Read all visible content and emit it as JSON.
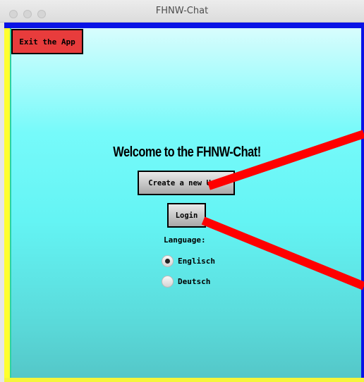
{
  "window": {
    "title": "FHNW-Chat"
  },
  "toolbar": {
    "exit_label": "Exit the App"
  },
  "main": {
    "welcome": "Welcome to the FHNW-Chat!",
    "create_user_label": "Create a new User",
    "login_label": "Login"
  },
  "language": {
    "label": "Language:",
    "options": [
      {
        "label": "Englisch",
        "selected": true
      },
      {
        "label": "Deutsch",
        "selected": false
      }
    ]
  },
  "colors": {
    "frame_yellow": "#ffff2e",
    "frame_blue": "#0a13e6",
    "exit_red": "#e83c3c",
    "annotation_red": "#ff0000",
    "background_cyan": "#76fafa"
  }
}
